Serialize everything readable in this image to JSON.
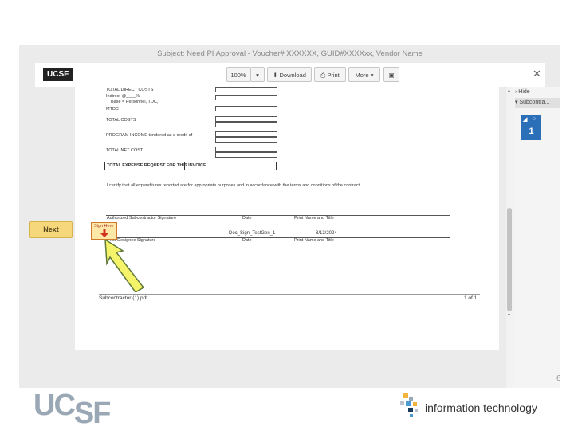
{
  "window": {
    "subject": "Subject: Need PI Approval - Voucher# XXXXXX, GUID#XXXXxx, Vendor Name"
  },
  "toolbar": {
    "logo": "UCSF",
    "zoom": "100%",
    "download": "Download",
    "print": "Print",
    "more": "More"
  },
  "document": {
    "rows": [
      {
        "label": "TOTAL DIRECT COSTS"
      },
      {
        "label": "Indirect @____%"
      },
      {
        "label": "Base = Personnel, TDC,"
      },
      {
        "label": "MTDC"
      },
      {
        "label": "TOTAL COSTS"
      },
      {
        "label": "PROGRAM INCOME tendered as a credit of"
      },
      {
        "label": "TOTAL NET COST"
      }
    ],
    "total_expense": "TOTAL EXPENSE REQUEST FOR THIS INVOICE",
    "certify": "I certify that all expenditures reported are for appropriate purposes and in accordance with the terms and conditions of the contract.",
    "sig_label": "Authorized Subcontractor Signature",
    "date_label": "Date",
    "name_label": "Print Name and Title",
    "signer_name": "Doc_Sign_TestGen_1",
    "sign_date": "8/13/2024",
    "pi_label": "Prior Designee Signature",
    "pi_date_label": "Date",
    "pi_name_label": "Print Name and Title",
    "file_name": "Subcontractor (1).pdf",
    "page_count": "1 of 1"
  },
  "signing": {
    "next_button": "Next",
    "sign_here": "Sign Here"
  },
  "side_panel": {
    "hide": "Hide",
    "tab": "Subcontra...",
    "page_badge": "1"
  },
  "slide": {
    "page_number": "6",
    "logo": "UCSF",
    "it_label": "information technology"
  },
  "colors": {
    "next_button": "#f6d77b",
    "arrow": "#f5f36a",
    "card": "#2b6fb8",
    "sign_arrow": "#d03020"
  }
}
